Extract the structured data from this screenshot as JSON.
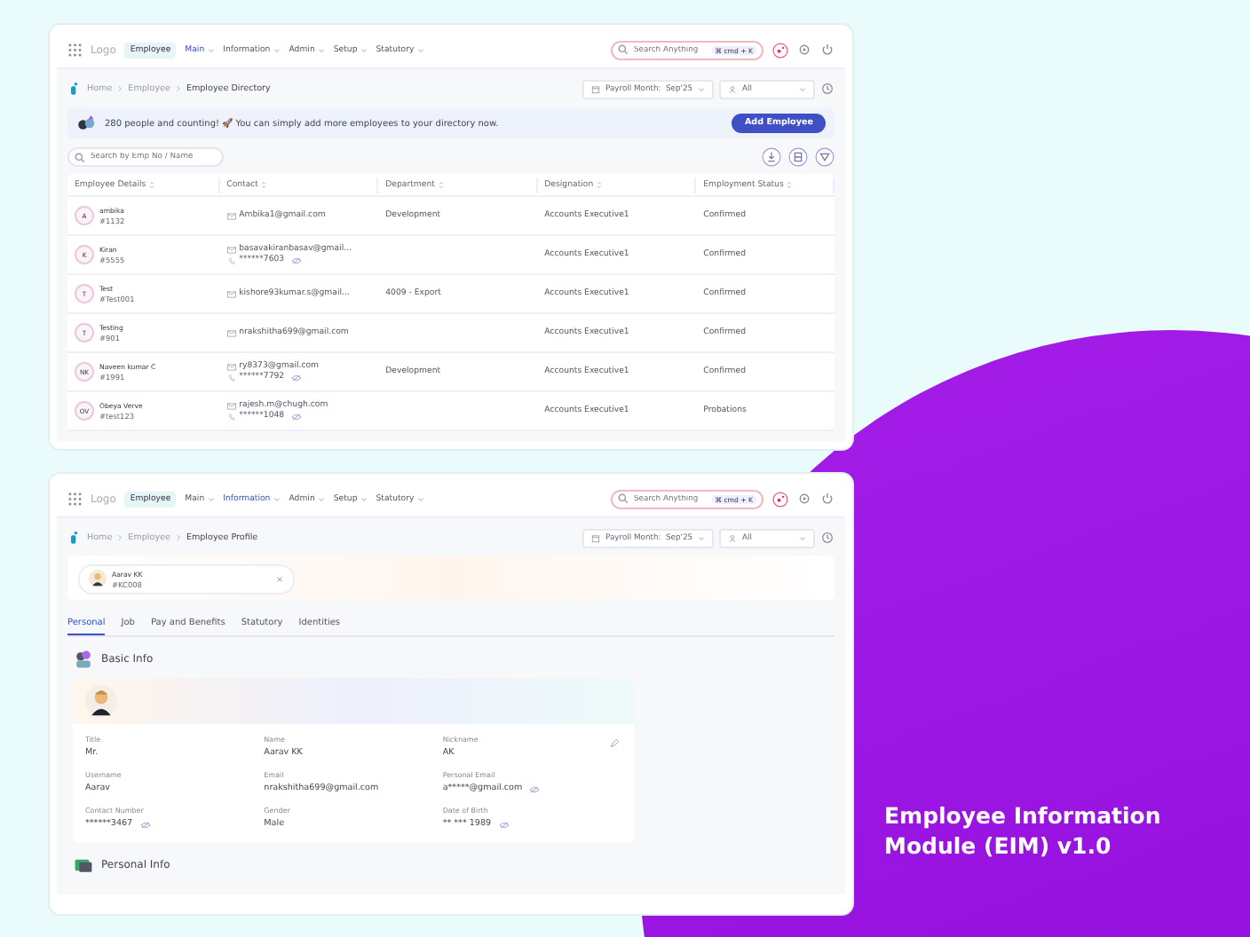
{
  "directory": {
    "nav": {
      "logo": "Logo",
      "module": "Employee",
      "items": [
        {
          "label": "Main",
          "selected": true
        },
        {
          "label": "Information",
          "selected": false
        },
        {
          "label": "Admin",
          "selected": false
        },
        {
          "label": "Setup",
          "selected": false
        },
        {
          "label": "Statutory",
          "selected": false
        }
      ],
      "search_placeholder": "Search Anything",
      "shortcut": "⌘ cmd + K"
    },
    "breadcrumb": [
      "Home",
      "Employee",
      "Employee Directory"
    ],
    "payroll": "Payroll Month:  Sep'25",
    "filter": "All",
    "banner": {
      "text": "280 people and counting! 🚀 You can simply add more employees to your directory now.",
      "button": "Add Employee"
    },
    "search_placeholder": "Search by Emp No / Name",
    "table": {
      "columns": [
        "Employee Details",
        "Contact",
        "Department",
        "Designation",
        "Employment Status"
      ],
      "rows": [
        {
          "initials": "A",
          "name": "ambika",
          "id": "#1132",
          "email": "Ambika1@gmail.com",
          "department": "Development",
          "designation": "Accounts Executive1",
          "status": "Confirmed"
        },
        {
          "initials": "K",
          "name": "Kiran",
          "id": "#5555",
          "email": "basavakiranbasav@gmail...",
          "phone": "******7603",
          "designation": "Accounts Executive1",
          "status": "Confirmed"
        },
        {
          "initials": "T",
          "name": "Test",
          "id": "#Test001",
          "email": "kishore93kumar.s@gmail...",
          "department": "4009 - Export",
          "designation": "Accounts Executive1",
          "status": "Confirmed"
        },
        {
          "initials": "T",
          "name": "Testing",
          "id": "#901",
          "email": "nrakshitha699@gmail.com",
          "designation": "Accounts Executive1",
          "status": "Confirmed"
        },
        {
          "initials": "NK",
          "name": "Naveen kumar C",
          "id": "#1991",
          "email": "ry8373@gmail.com",
          "phone": "******7792",
          "department": "Development",
          "designation": "Accounts Executive1",
          "status": "Confirmed"
        },
        {
          "initials": "OV",
          "name": "Obeya Verve",
          "id": "#test123",
          "email": "rajesh.m@chugh.com",
          "phone": "******1048",
          "designation": "Accounts Executive1",
          "status": "Probations"
        }
      ]
    }
  },
  "profile": {
    "nav": {
      "logo": "Logo",
      "module": "Employee",
      "items": [
        {
          "label": "Main",
          "selected": false
        },
        {
          "label": "Information",
          "selected": true
        },
        {
          "label": "Admin",
          "selected": false
        },
        {
          "label": "Setup",
          "selected": false
        },
        {
          "label": "Statutory",
          "selected": false
        }
      ],
      "search_placeholder": "Search Anything",
      "shortcut": "⌘ cmd + K"
    },
    "breadcrumb": [
      "Home",
      "Employee",
      "Employee Profile"
    ],
    "payroll": "Payroll Month:  Sep'25",
    "filter": "All",
    "employee": {
      "name": "Aarav KK",
      "id": "#KC008"
    },
    "tabs": [
      {
        "label": "Personal",
        "selected": true
      },
      {
        "label": "Job",
        "selected": false
      },
      {
        "label": "Pay and Benefits",
        "selected": false
      },
      {
        "label": "Statutory",
        "selected": false
      },
      {
        "label": "Identities",
        "selected": false
      }
    ],
    "section": "Basic Info",
    "fields": [
      {
        "label": "Title",
        "value": "Mr.",
        "masked": false
      },
      {
        "label": "Name",
        "value": "Aarav KK",
        "masked": false
      },
      {
        "label": "Nickname",
        "value": "AK",
        "masked": false
      },
      {
        "label": "Username",
        "value": "Aarav",
        "masked": false
      },
      {
        "label": "Email",
        "value": "nrakshitha699@gmail.com",
        "masked": false
      },
      {
        "label": "Personal Email",
        "value": "a*****@gmail.com",
        "masked": true
      },
      {
        "label": "Contact Number",
        "value": "******3467",
        "masked": true
      },
      {
        "label": "Gender",
        "value": "Male",
        "masked": false
      },
      {
        "label": "Date of Birth",
        "value": "** *** 1989",
        "masked": true
      }
    ],
    "next_section": "Personal Info"
  },
  "caption": [
    "Employee Information",
    "Module (EIM) v1.0"
  ]
}
